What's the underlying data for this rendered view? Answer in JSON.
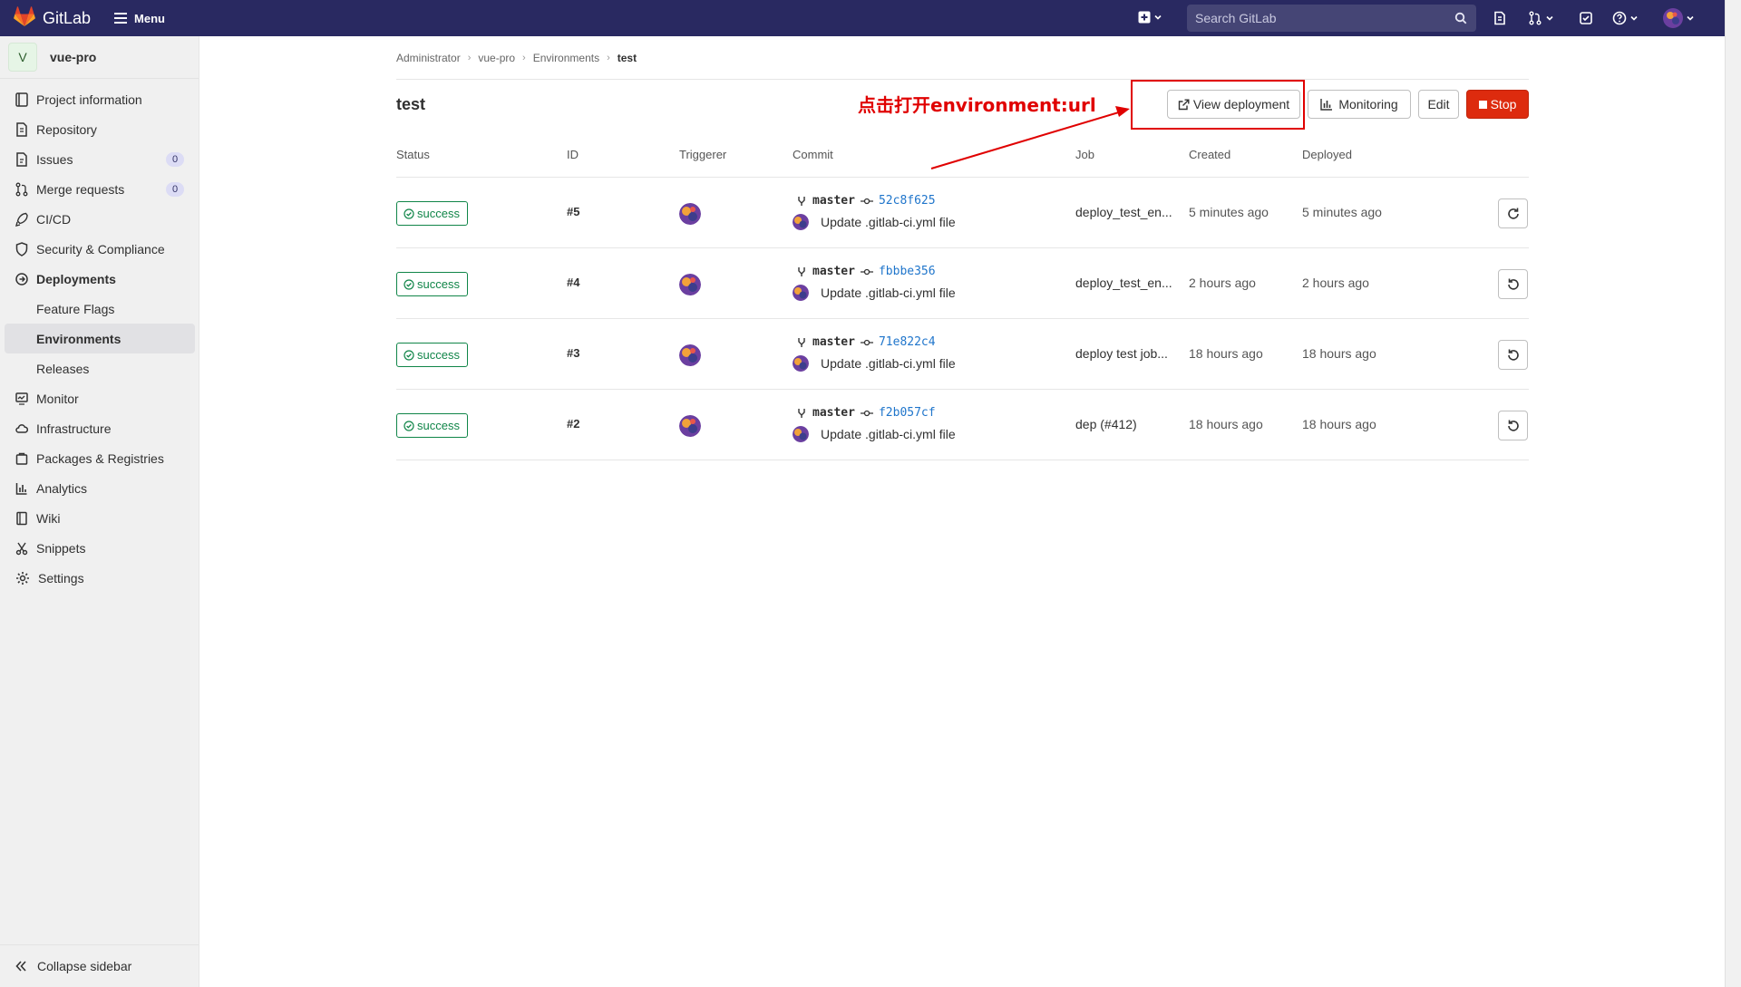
{
  "topbar": {
    "brand": "GitLab",
    "menu_label": "Menu",
    "search_placeholder": "Search GitLab"
  },
  "project": {
    "avatar_letter": "V",
    "name": "vue-pro"
  },
  "sidebar": {
    "items": [
      {
        "label": "Project information",
        "icon": "project-info-icon"
      },
      {
        "label": "Repository",
        "icon": "repository-icon"
      },
      {
        "label": "Issues",
        "icon": "issues-icon",
        "count": "0"
      },
      {
        "label": "Merge requests",
        "icon": "merge-request-icon",
        "count": "0"
      },
      {
        "label": "CI/CD",
        "icon": "rocket-icon"
      },
      {
        "label": "Security & Compliance",
        "icon": "shield-icon"
      },
      {
        "label": "Deployments",
        "icon": "deployments-icon"
      },
      {
        "label": "Feature Flags"
      },
      {
        "label": "Environments"
      },
      {
        "label": "Releases"
      },
      {
        "label": "Monitor",
        "icon": "monitor-icon"
      },
      {
        "label": "Infrastructure",
        "icon": "cloud-icon"
      },
      {
        "label": "Packages & Registries",
        "icon": "package-icon"
      },
      {
        "label": "Analytics",
        "icon": "chart-icon"
      },
      {
        "label": "Wiki",
        "icon": "book-icon"
      },
      {
        "label": "Snippets",
        "icon": "scissors-icon"
      },
      {
        "label": "Settings",
        "icon": "gear-icon"
      }
    ],
    "collapse_label": "Collapse sidebar"
  },
  "breadcrumb": [
    "Administrator",
    "vue-pro",
    "Environments",
    "test"
  ],
  "environment": {
    "title": "test",
    "annotation": "点击打开environment:url"
  },
  "buttons": {
    "view_deployment": "View deployment",
    "monitoring": "Monitoring",
    "edit": "Edit",
    "stop": "Stop"
  },
  "table": {
    "headers": [
      "Status",
      "ID",
      "Triggerer",
      "Commit",
      "Job",
      "Created",
      "Deployed"
    ],
    "rows": [
      {
        "status": "success",
        "id": "#5",
        "branch": "master",
        "sha": "52c8f625",
        "title": "Update .gitlab-ci.yml file",
        "job": "deploy_test_en...",
        "created": "5 minutes ago",
        "deployed": "5 minutes ago",
        "action_icon": "retry-icon"
      },
      {
        "status": "success",
        "id": "#4",
        "branch": "master",
        "sha": "fbbbe356",
        "title": "Update .gitlab-ci.yml file",
        "job": "deploy_test_en...",
        "created": "2 hours ago",
        "deployed": "2 hours ago",
        "action_icon": "rollback-icon"
      },
      {
        "status": "success",
        "id": "#3",
        "branch": "master",
        "sha": "71e822c4",
        "title": "Update .gitlab-ci.yml file",
        "job": "deploy test job...",
        "created": "18 hours ago",
        "deployed": "18 hours ago",
        "action_icon": "rollback-icon"
      },
      {
        "status": "success",
        "id": "#2",
        "branch": "master",
        "sha": "f2b057cf",
        "title": "Update .gitlab-ci.yml file",
        "job": "dep (#412)",
        "created": "18 hours ago",
        "deployed": "18 hours ago",
        "action_icon": "rollback-icon"
      }
    ]
  },
  "colors": {
    "topbar": "#292961",
    "success": "#108548",
    "danger": "#dd2b0e",
    "annotation": "#e00000",
    "link": "#1f75cb"
  }
}
